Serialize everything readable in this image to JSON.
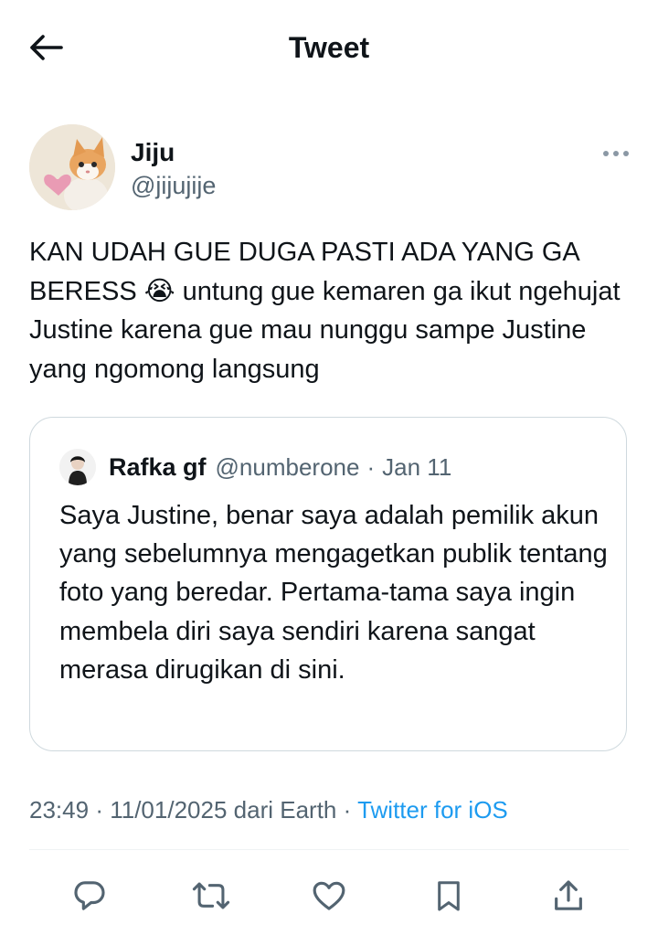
{
  "header": {
    "title": "Tweet",
    "back_icon": "arrow-left-icon"
  },
  "author": {
    "name": "Jiju",
    "handle": "@jijujije",
    "avatar": "kitten-with-heart-avatar",
    "more_icon": "more-horizontal-icon"
  },
  "tweet": {
    "text": "KAN UDAH GUE DUGA PASTI ADA YANG GA BERESS 😭 untung gue kemaren ga ikut ngehujat Justine karena gue mau nunggu sampe Justine yang ngomong langsung"
  },
  "quote": {
    "name": "Rafka gf",
    "handle": "@numberone",
    "separator": "·",
    "date": "Jan 11",
    "text": "Saya Justine, benar saya adalah pemilik akun yang sebelumnya mengagetkan publik tentang foto yang beredar. Pertama-tama saya ingin membela diri saya sendiri karena sangat merasa dirugikan di sini."
  },
  "meta": {
    "time": "23:49",
    "separator": "·",
    "date": "11/01/2025",
    "location": "dari Earth",
    "source": "Twitter for iOS"
  },
  "actions": [
    {
      "name": "reply-icon"
    },
    {
      "name": "retweet-icon"
    },
    {
      "name": "like-icon"
    },
    {
      "name": "bookmark-icon"
    },
    {
      "name": "share-icon"
    }
  ],
  "colors": {
    "text": "#0f1419",
    "secondary": "#536471",
    "link": "#1d9bf0",
    "border": "#cfd9de"
  }
}
